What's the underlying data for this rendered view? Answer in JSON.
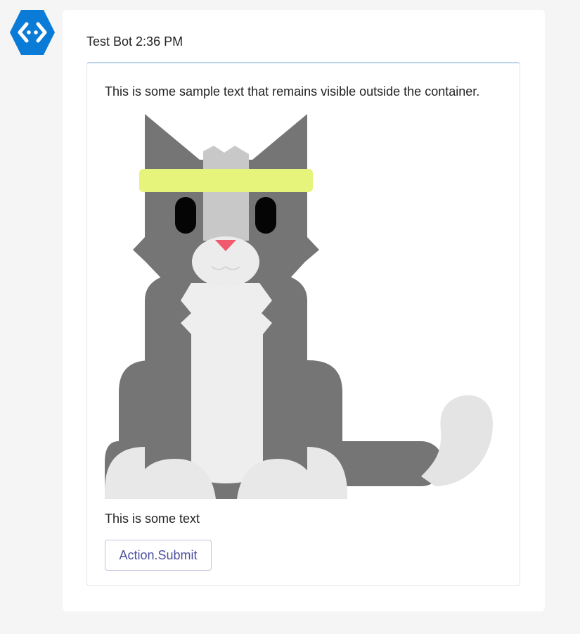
{
  "bot": {
    "name": "Test Bot",
    "time": "2:36 PM",
    "avatar_icon": "bot-code-icon",
    "avatar_color": "#0078d4"
  },
  "card": {
    "text_top": "This is some sample text that remains visible outside the container.",
    "image": "cat-with-headband-illustration",
    "text_bottom": "This is some text",
    "action_label": "Action.Submit",
    "accent_color": "#b9d3ec",
    "button_text_color": "#4d4f9e"
  }
}
